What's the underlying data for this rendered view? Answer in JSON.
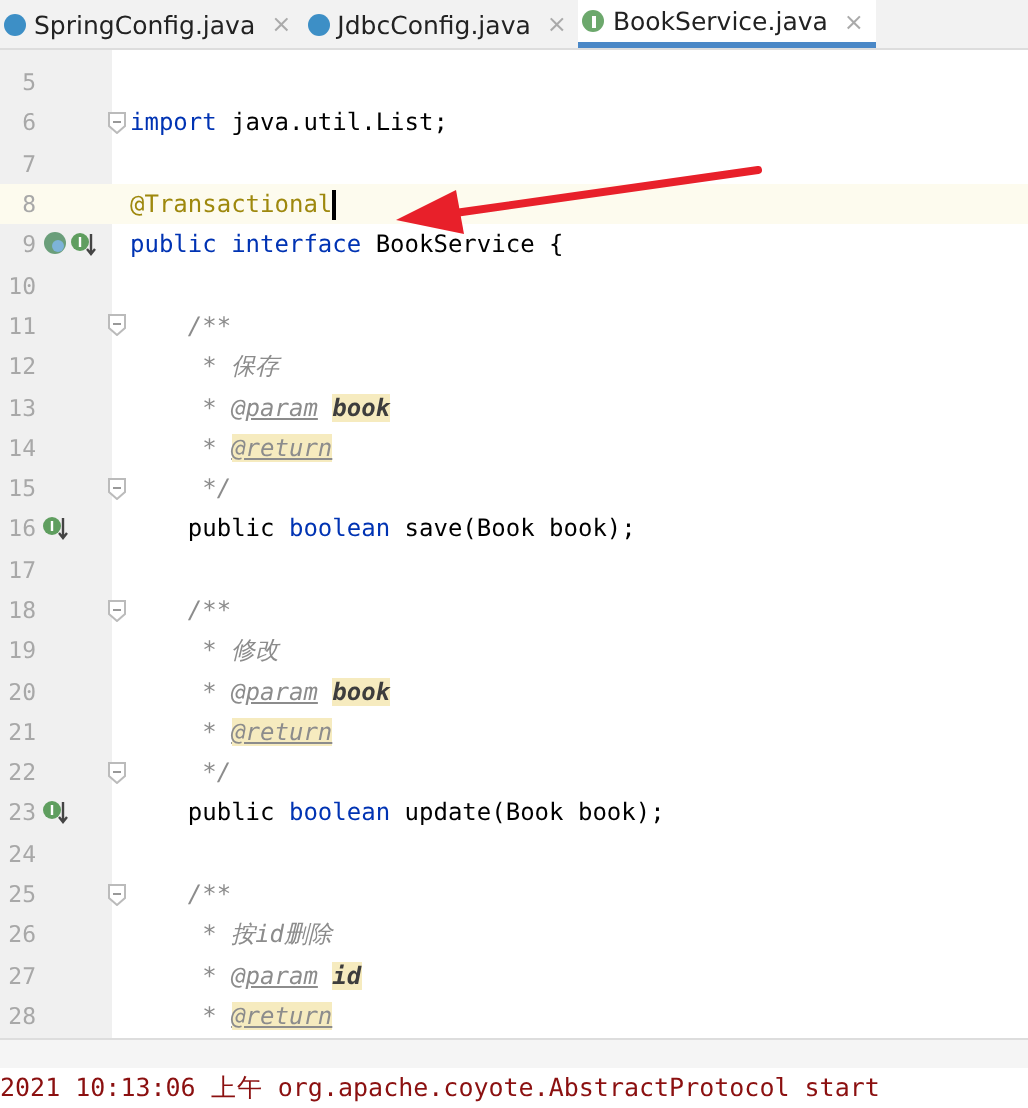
{
  "tabs": [
    {
      "label": "SpringConfig.java",
      "kind": "class",
      "close": "×",
      "selected": false
    },
    {
      "label": "JdbcConfig.java",
      "kind": "class",
      "close": "×",
      "selected": false
    },
    {
      "label": "BookService.java",
      "kind": "interface",
      "close": "×",
      "selected": true
    }
  ],
  "editor": {
    "lines": [
      {
        "num": "5",
        "fold": false,
        "current": false
      },
      {
        "num": "6",
        "tokens": [
          {
            "kind": "keyword",
            "text": "import"
          },
          {
            "kind": "plain",
            "text": " java.util.List;"
          }
        ],
        "fold": true,
        "current": false
      },
      {
        "num": "7",
        "fold": false,
        "current": false
      },
      {
        "num": "8",
        "tokens": [
          {
            "kind": "annotation",
            "text": "@Transactional"
          }
        ],
        "fold": false,
        "current": true
      },
      {
        "num": "9",
        "tokens": [
          {
            "kind": "keyword",
            "text": "public interface"
          },
          {
            "kind": "plain",
            "text": " BookService {"
          }
        ],
        "gutter": [
          {
            "kind": "bean"
          },
          {
            "kind": "implemented"
          }
        ],
        "fold": false,
        "current": false
      },
      {
        "num": "10",
        "fold": false,
        "current": false
      },
      {
        "num": "11",
        "tokens": [
          {
            "kind": "comment",
            "text": "    /**"
          }
        ],
        "fold": true,
        "current": false
      },
      {
        "num": "12",
        "tokens": [
          {
            "kind": "comment",
            "text": "     * 保存"
          }
        ],
        "fold": false,
        "current": false
      },
      {
        "num": "13",
        "tokens": [
          {
            "kind": "comment",
            "text": "     * "
          },
          {
            "kind": "doctag",
            "text": "@param"
          },
          {
            "kind": "docparam",
            "text": "book"
          }
        ],
        "fold": false,
        "current": false
      },
      {
        "num": "14",
        "tokens": [
          {
            "kind": "comment",
            "text": "     * "
          },
          {
            "kind": "doctag-hl",
            "text": "@return"
          }
        ],
        "fold": false,
        "current": false
      },
      {
        "num": "15",
        "tokens": [
          {
            "kind": "comment",
            "text": "     */"
          }
        ],
        "fold": true,
        "current": false
      },
      {
        "num": "16",
        "tokens": [
          {
            "kind": "plain",
            "text": "    public "
          },
          {
            "kind": "keyword",
            "text": "boolean"
          },
          {
            "kind": "plain",
            "text": " save(Book book);"
          }
        ],
        "gutter": [
          {
            "kind": "implemented"
          }
        ],
        "fold": false,
        "current": false
      },
      {
        "num": "17",
        "fold": false,
        "current": false
      },
      {
        "num": "18",
        "tokens": [
          {
            "kind": "comment",
            "text": "    /**"
          }
        ],
        "fold": true,
        "current": false
      },
      {
        "num": "19",
        "tokens": [
          {
            "kind": "comment",
            "text": "     * 修改"
          }
        ],
        "fold": false,
        "current": false
      },
      {
        "num": "20",
        "tokens": [
          {
            "kind": "comment",
            "text": "     * "
          },
          {
            "kind": "doctag",
            "text": "@param"
          },
          {
            "kind": "docparam",
            "text": "book"
          }
        ],
        "fold": false,
        "current": false
      },
      {
        "num": "21",
        "tokens": [
          {
            "kind": "comment",
            "text": "     * "
          },
          {
            "kind": "doctag-hl",
            "text": "@return"
          }
        ],
        "fold": false,
        "current": false
      },
      {
        "num": "22",
        "tokens": [
          {
            "kind": "comment",
            "text": "     */"
          }
        ],
        "fold": true,
        "current": false
      },
      {
        "num": "23",
        "tokens": [
          {
            "kind": "plain",
            "text": "    public "
          },
          {
            "kind": "keyword",
            "text": "boolean"
          },
          {
            "kind": "plain",
            "text": " update(Book book);"
          }
        ],
        "gutter": [
          {
            "kind": "implemented"
          }
        ],
        "fold": false,
        "current": false
      },
      {
        "num": "24",
        "fold": false,
        "current": false
      },
      {
        "num": "25",
        "tokens": [
          {
            "kind": "comment",
            "text": "    /**"
          }
        ],
        "fold": true,
        "current": false
      },
      {
        "num": "26",
        "tokens": [
          {
            "kind": "comment",
            "text": "     * 按id删除"
          }
        ],
        "fold": false,
        "current": false
      },
      {
        "num": "27",
        "tokens": [
          {
            "kind": "comment",
            "text": "     * "
          },
          {
            "kind": "doctag",
            "text": "@param"
          },
          {
            "kind": "docparam",
            "text": "id"
          }
        ],
        "fold": false,
        "current": false
      },
      {
        "num": "28",
        "tokens": [
          {
            "kind": "comment",
            "text": "     * "
          },
          {
            "kind": "doctag-hl",
            "text": "@return"
          }
        ],
        "fold": false,
        "current": false
      }
    ]
  },
  "console": {
    "line": "2021 10:13:06 上午 org.apache.coyote.AbstractProtocol start"
  }
}
